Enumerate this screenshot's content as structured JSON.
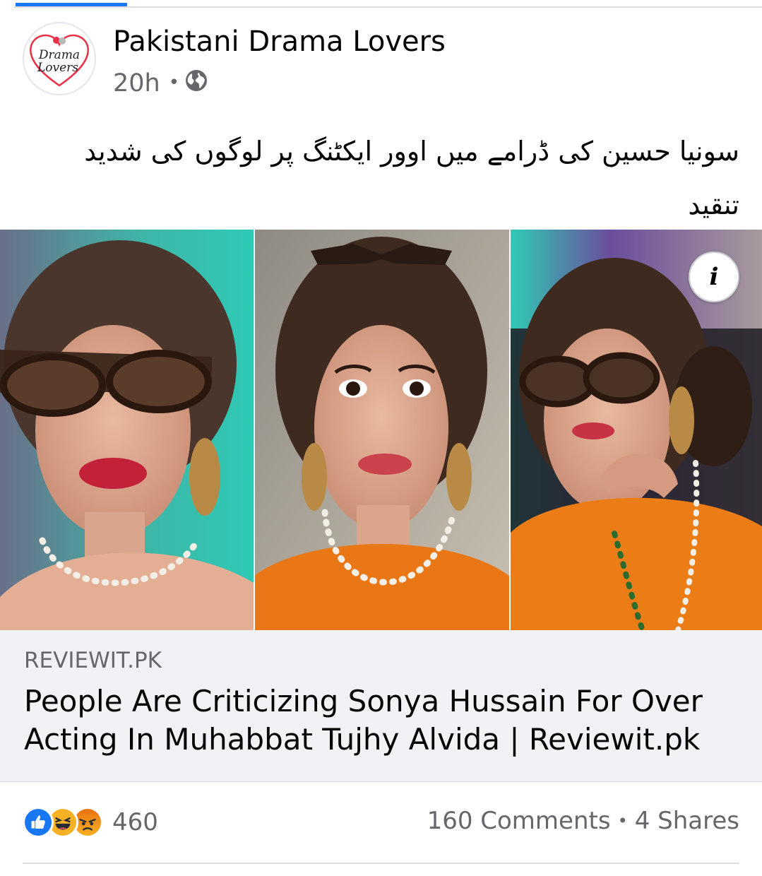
{
  "page": {
    "name": "Pakistani Drama Lovers",
    "avatar_icon": "drama-lovers-logo-icon",
    "avatar_logo_text_line1": "Drama",
    "avatar_logo_text_line2": "Lovers"
  },
  "post": {
    "time": "20h",
    "separator": "•",
    "audience_icon": "globe-icon",
    "text": "سونیا حسین کی ڈرامے میں اوور ایکٹنگ پر لوگوں کی شدید تنقید"
  },
  "link": {
    "image_description_icon": "info-icon",
    "info_label": "i",
    "domain": "REVIEWIT.PK",
    "title": "People Are Criticizing Sonya Hussain For Over Acting In Muhabbat Tujhy Alvida | Reviewit.pk"
  },
  "reactions": {
    "icons": [
      "like-icon",
      "haha-icon",
      "angry-icon"
    ],
    "count": "460"
  },
  "engagement": {
    "comments": "160 Comments",
    "separator": "•",
    "shares": "4 Shares"
  },
  "colors": {
    "brand_blue": "#1877f2",
    "secondary_text": "#65676b",
    "caption_background": "#f0f2f5",
    "haha_yellow": "#f7b125",
    "angry_orange": "#e9710f"
  }
}
